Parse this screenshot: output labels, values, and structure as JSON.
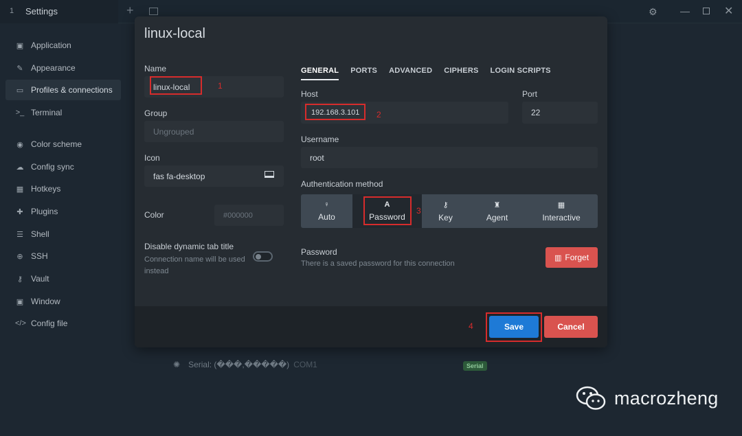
{
  "titlebar": {
    "tab_number": "1",
    "title": "Settings"
  },
  "sidebar": {
    "items": [
      {
        "label": "Application",
        "icon": "window-icon"
      },
      {
        "label": "Appearance",
        "icon": "brush-icon"
      },
      {
        "label": "Profiles & connections",
        "icon": "laptop-icon"
      },
      {
        "label": "Terminal",
        "icon": "terminal-icon"
      },
      {
        "label": "Color scheme",
        "icon": "palette-icon"
      },
      {
        "label": "Config sync",
        "icon": "cloud-icon"
      },
      {
        "label": "Hotkeys",
        "icon": "keyboard-icon"
      },
      {
        "label": "Plugins",
        "icon": "puzzle-icon"
      },
      {
        "label": "Shell",
        "icon": "list-icon"
      },
      {
        "label": "SSH",
        "icon": "globe-icon"
      },
      {
        "label": "Vault",
        "icon": "key-icon"
      },
      {
        "label": "Window",
        "icon": "window-icon"
      },
      {
        "label": "Config file",
        "icon": "code-icon"
      }
    ]
  },
  "background": {
    "serial_label": "Serial: (���,�����)",
    "serial_port": "COM1",
    "badge": "Serial"
  },
  "modal": {
    "title": "linux-local",
    "name_label": "Name",
    "name_value": "linux-local",
    "group_label": "Group",
    "group_placeholder": "Ungrouped",
    "icon_label": "Icon",
    "icon_value": "fas fa-desktop",
    "color_label": "Color",
    "color_placeholder": "#000000",
    "dynamic_title_label": "Disable dynamic tab title",
    "dynamic_title_hint": "Connection name will be used instead",
    "tabs": [
      "GENERAL",
      "PORTS",
      "ADVANCED",
      "CIPHERS",
      "LOGIN SCRIPTS"
    ],
    "host_label": "Host",
    "host_value": "192.168.3.101",
    "port_label": "Port",
    "port_value": "22",
    "username_label": "Username",
    "username_value": "root",
    "auth_label": "Authentication method",
    "auth_options": [
      {
        "label": "Auto",
        "icon": "lightbulb-icon"
      },
      {
        "label": "Password",
        "icon": "font-icon"
      },
      {
        "label": "Key",
        "icon": "key-icon"
      },
      {
        "label": "Agent",
        "icon": "user-secret-icon"
      },
      {
        "label": "Interactive",
        "icon": "keyboard-icon"
      }
    ],
    "auth_selected": "Password",
    "password_label": "Password",
    "password_hint": "There is a saved password for this connection",
    "forget_label": "Forget",
    "save_label": "Save",
    "cancel_label": "Cancel"
  },
  "annotations": [
    "1",
    "2",
    "3",
    "4"
  ],
  "watermark": "macrozheng",
  "colors": {
    "accent": "#1e7ad6",
    "danger": "#d9534f",
    "annotation": "#d72c2c"
  }
}
